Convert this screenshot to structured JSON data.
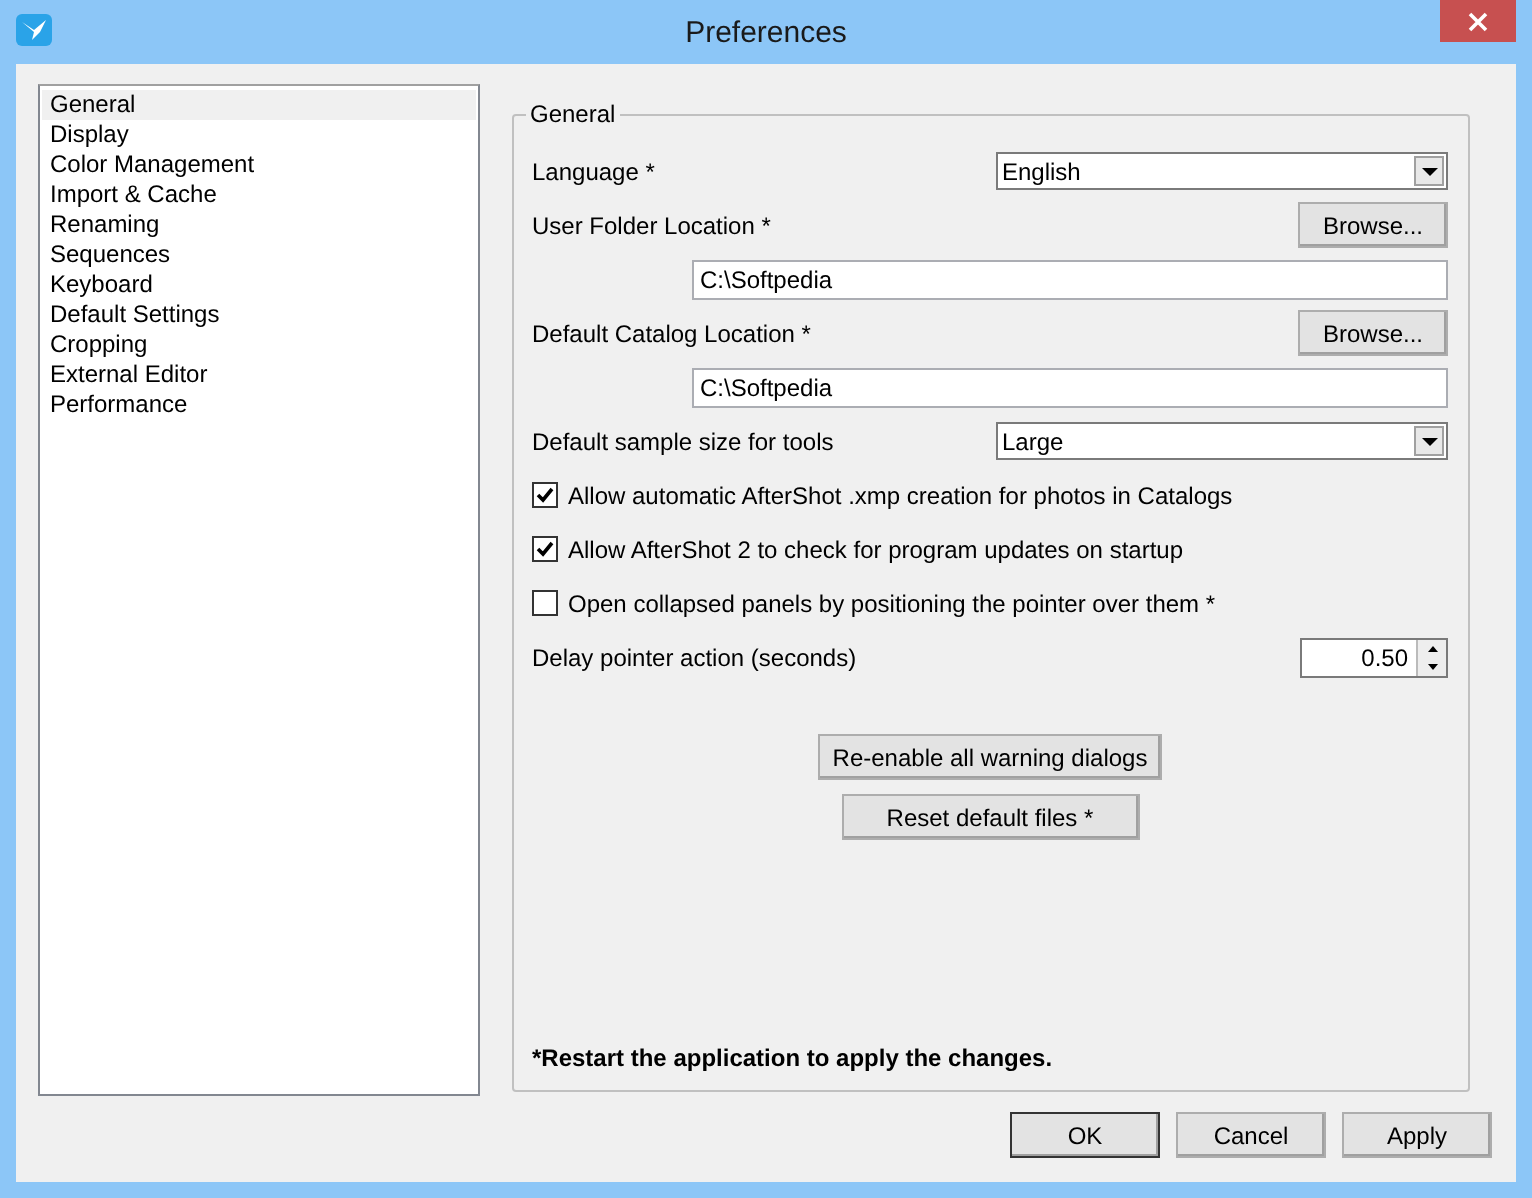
{
  "window": {
    "title": "Preferences"
  },
  "sidebar": {
    "items": [
      {
        "label": "General",
        "selected": true
      },
      {
        "label": "Display",
        "selected": false
      },
      {
        "label": "Color Management",
        "selected": false
      },
      {
        "label": "Import & Cache",
        "selected": false
      },
      {
        "label": "Renaming",
        "selected": false
      },
      {
        "label": "Sequences",
        "selected": false
      },
      {
        "label": "Keyboard",
        "selected": false
      },
      {
        "label": "Default Settings",
        "selected": false
      },
      {
        "label": "Cropping",
        "selected": false
      },
      {
        "label": "External Editor",
        "selected": false
      },
      {
        "label": "Performance",
        "selected": false
      }
    ]
  },
  "group": {
    "title": "General",
    "settings": [
      {
        "kind": "select",
        "label": "Language *",
        "value": "English"
      },
      {
        "kind": "browse",
        "label": "User Folder Location *",
        "button": "Browse..."
      },
      {
        "kind": "path",
        "value": "C:\\Softpedia"
      },
      {
        "kind": "browse",
        "label": "Default Catalog Location *",
        "button": "Browse..."
      },
      {
        "kind": "path",
        "value": "C:\\Softpedia"
      },
      {
        "kind": "select",
        "label": "Default sample size for tools",
        "value": "Large"
      },
      {
        "kind": "checkbox",
        "label": "Allow automatic AfterShot .xmp creation for photos in Catalogs",
        "checked": true
      },
      {
        "kind": "checkbox",
        "label": "Allow AfterShot 2 to check for program updates on startup",
        "checked": true
      },
      {
        "kind": "checkbox",
        "label": "Open collapsed panels by positioning the pointer over them *",
        "checked": false
      },
      {
        "kind": "spin",
        "label": "Delay pointer action (seconds)",
        "value": "0.50"
      }
    ],
    "actions": [
      "Re-enable all warning dialogs",
      "Reset default files *"
    ],
    "note": "*Restart the application to apply the changes."
  },
  "buttons": [
    "OK",
    "Cancel",
    "Apply"
  ]
}
